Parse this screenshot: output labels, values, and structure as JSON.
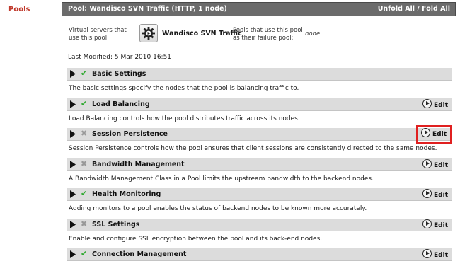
{
  "nav": {
    "pools_label": "Pools"
  },
  "header": {
    "title": "Pool: Wandisco SVN Traffic (HTTP, 1 node)",
    "fold_label": "Unfold All / Fold All"
  },
  "virtual_servers": {
    "label": "Virtual servers that use this pool:",
    "name": "Wandisco SVN Traffic",
    "failure_pool_label": "Pools that use this pool as their failure pool:",
    "failure_pool_value": "none"
  },
  "last_modified": "Last Modified: 5 Mar 2010 16:51",
  "edit_label": "Edit",
  "sections": [
    {
      "title": "Basic Settings",
      "enabled": true,
      "has_edit": false,
      "highlight": false,
      "desc": "The basic settings specify the nodes that the pool is balancing traffic to."
    },
    {
      "title": "Load Balancing",
      "enabled": true,
      "has_edit": true,
      "highlight": false,
      "desc": "Load Balancing controls how the pool distributes traffic across its nodes."
    },
    {
      "title": "Session Persistence",
      "enabled": false,
      "has_edit": true,
      "highlight": true,
      "desc": "Session Persistence controls how the pool ensures that client sessions are consistently directed to the same nodes."
    },
    {
      "title": "Bandwidth Management",
      "enabled": false,
      "has_edit": true,
      "highlight": false,
      "desc": "A Bandwidth Management Class in a Pool limits the upstream bandwidth to the backend nodes."
    },
    {
      "title": "Health Monitoring",
      "enabled": true,
      "has_edit": true,
      "highlight": false,
      "desc": "Adding monitors to a pool enables the status of backend nodes to be known more accurately."
    },
    {
      "title": "SSL Settings",
      "enabled": false,
      "has_edit": true,
      "highlight": false,
      "desc": "Enable and configure SSL encryption between the pool and its back-end nodes."
    },
    {
      "title": "Connection Management",
      "enabled": true,
      "has_edit": true,
      "highlight": false,
      "desc": ""
    }
  ],
  "colors": {
    "highlight_border": "#e02020",
    "enabled_check": "#2ea82e",
    "title_bar": "#6b6b6b",
    "nav_link": "#c0392b"
  }
}
